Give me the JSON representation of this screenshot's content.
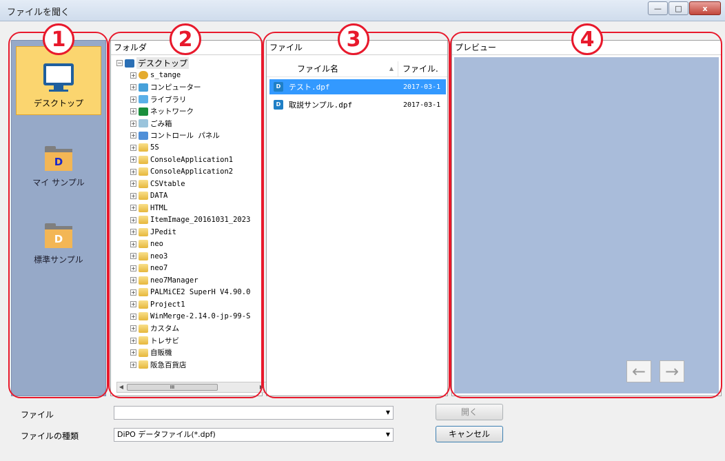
{
  "window": {
    "title": "ファイルを聞く",
    "controls": {
      "minimize": "—",
      "maximize": "□",
      "close": "x"
    }
  },
  "places": [
    {
      "label": "デスクトップ",
      "icon": "desktop-monitor-icon",
      "selected": true
    },
    {
      "label": "マイ サンプル",
      "icon": "d-folder-icon",
      "letter": "D"
    },
    {
      "label": "標準サンプル",
      "icon": "d-folder-icon",
      "letter": "D"
    }
  ],
  "folder_panel": {
    "header": "フォルダ",
    "root": "デスクトップ",
    "items": [
      {
        "label": "s_tange",
        "icon": "user"
      },
      {
        "label": "コンピューター",
        "icon": "computer"
      },
      {
        "label": "ライブラリ",
        "icon": "library"
      },
      {
        "label": "ネットワーク",
        "icon": "network"
      },
      {
        "label": "ごみ箱",
        "icon": "trash"
      },
      {
        "label": "コントロール パネル",
        "icon": "control"
      },
      {
        "label": "5S",
        "icon": "folder"
      },
      {
        "label": "ConsoleApplication1",
        "icon": "folder"
      },
      {
        "label": "ConsoleApplication2",
        "icon": "folder"
      },
      {
        "label": "CSVtable",
        "icon": "folder"
      },
      {
        "label": "DATA",
        "icon": "folder"
      },
      {
        "label": "HTML",
        "icon": "folder"
      },
      {
        "label": "ItemImage_20161031_2023",
        "icon": "folder"
      },
      {
        "label": "JPedit",
        "icon": "folder"
      },
      {
        "label": "neo",
        "icon": "folder"
      },
      {
        "label": "neo3",
        "icon": "folder"
      },
      {
        "label": "neo7",
        "icon": "folder"
      },
      {
        "label": "neo7Manager",
        "icon": "folder"
      },
      {
        "label": "PALMiCE2 SuperH V4.90.0",
        "icon": "folder"
      },
      {
        "label": "Project1",
        "icon": "folder"
      },
      {
        "label": "WinMerge-2.14.0-jp-99-S",
        "icon": "folder"
      },
      {
        "label": "カスタム",
        "icon": "folder"
      },
      {
        "label": "トレサビ",
        "icon": "folder"
      },
      {
        "label": "自販機",
        "icon": "folder"
      },
      {
        "label": "阪急百貨店",
        "icon": "folder"
      }
    ],
    "scroll_thumb": "III"
  },
  "file_panel": {
    "header": "ファイル",
    "columns": {
      "name": "ファイル名",
      "date": "ファイル."
    },
    "files": [
      {
        "name": "テスト.dpf",
        "date": "2017-03-1",
        "selected": true
      },
      {
        "name": "取説サンプル.dpf",
        "date": "2017-03-1",
        "selected": false
      }
    ]
  },
  "preview_panel": {
    "header": "プレビュー",
    "prev": "←",
    "next": "→"
  },
  "annotations": [
    "1",
    "2",
    "3",
    "4"
  ],
  "form": {
    "file_label": "ファイル",
    "file_value": "",
    "type_label": "ファイルの種類",
    "type_value": "DiPO データファイル(*.dpf)",
    "open_button": "開く",
    "cancel_button": "キャンセル"
  },
  "colors": {
    "annotation": "#e8192c",
    "places_bg": "#96a9c8",
    "selected_place": "#fbd56f",
    "selection": "#3399ff",
    "preview_bg": "#a9bcda"
  }
}
